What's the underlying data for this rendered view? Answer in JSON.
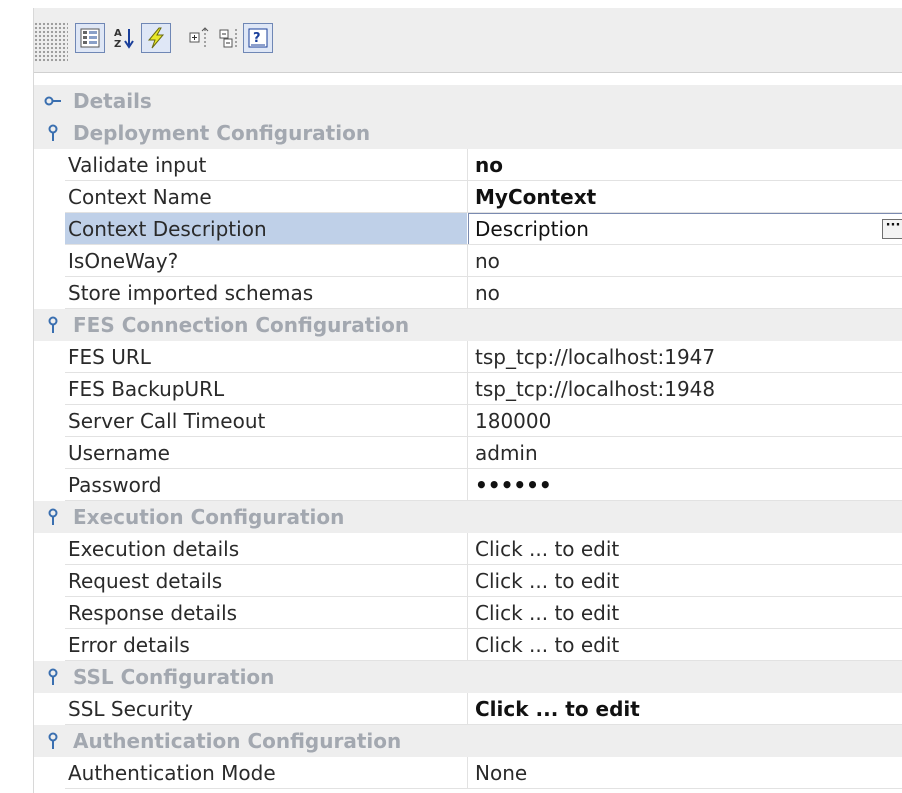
{
  "toolbar": {
    "buttons": [
      {
        "icon": "categorized-view-icon",
        "pressed": true
      },
      {
        "icon": "sort-alphabetical-icon",
        "pressed": false
      },
      {
        "icon": "lightning-icon",
        "pressed": true
      },
      {
        "icon": "expand-all-icon",
        "pressed": false
      },
      {
        "icon": "collapse-all-icon",
        "pressed": false
      },
      {
        "icon": "help-description-icon",
        "pressed": true
      }
    ]
  },
  "details_label": "Details",
  "sections": [
    {
      "title": "Deployment Configuration",
      "rows": [
        {
          "name": "Validate input",
          "value": "no",
          "bold": true
        },
        {
          "name": "Context Name",
          "value": "MyContext",
          "bold": true
        },
        {
          "name": "Context Description",
          "value": "Description",
          "editing": true,
          "button": "···"
        },
        {
          "name": "IsOneWay?",
          "value": "no"
        },
        {
          "name": "Store imported schemas",
          "value": "no"
        }
      ]
    },
    {
      "title": "FES Connection Configuration",
      "rows": [
        {
          "name": "FES URL",
          "value": "tsp_tcp://localhost:1947"
        },
        {
          "name": "FES BackupURL",
          "value": "tsp_tcp://localhost:1948"
        },
        {
          "name": "Server Call Timeout",
          "value": "180000"
        },
        {
          "name": "Username",
          "value": "admin"
        },
        {
          "name": "Password",
          "value": "••••••",
          "bold": true
        }
      ]
    },
    {
      "title": "Execution Configuration",
      "rows": [
        {
          "name": "Execution details",
          "value": "Click ... to edit"
        },
        {
          "name": "Request details",
          "value": "Click ... to edit"
        },
        {
          "name": "Response details",
          "value": "Click ... to edit"
        },
        {
          "name": "Error details",
          "value": "Click ... to edit"
        }
      ]
    },
    {
      "title": "SSL Configuration",
      "rows": [
        {
          "name": "SSL Security",
          "value": "Click ... to edit",
          "bold": true
        }
      ]
    },
    {
      "title": "Authentication Configuration",
      "rows": [
        {
          "name": "Authentication Mode",
          "value": "None"
        }
      ]
    }
  ],
  "colors": {
    "category_background": "#eeeeee",
    "category_text": "#a3a8b0",
    "selection": "#bfd0e8",
    "toolbar_pressed": "#dfe7f6"
  }
}
